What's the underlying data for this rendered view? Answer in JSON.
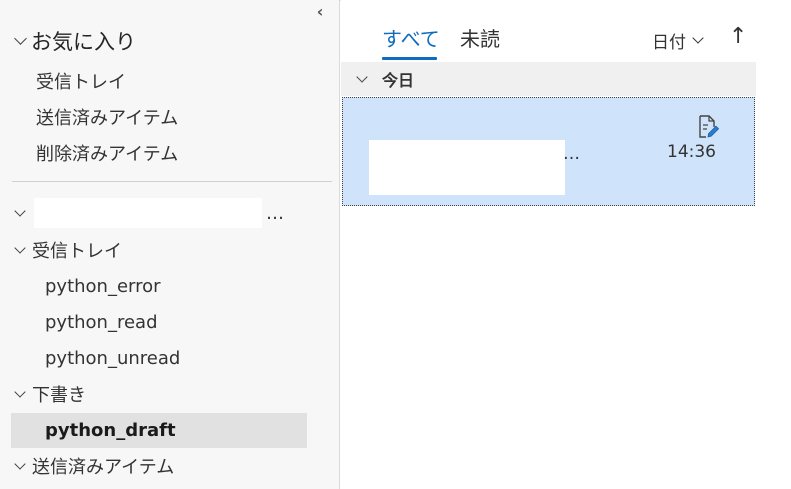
{
  "sidebar": {
    "collapse_glyph": "‹",
    "favorites": {
      "title": "お気に入り",
      "items": [
        "受信トレイ",
        "送信済みアイテム",
        "削除済みアイテム"
      ]
    },
    "account": {
      "more": "…"
    },
    "folders": {
      "inbox": "受信トレイ",
      "inbox_children": [
        "python_error",
        "python_read",
        "python_unread"
      ],
      "drafts": "下書き",
      "drafts_children": [
        "python_draft"
      ],
      "sent": "送信済みアイテム"
    }
  },
  "main": {
    "tabs": {
      "all": "すべて",
      "unread": "未読"
    },
    "sort": {
      "label": "日付",
      "direction_glyph": "↑"
    },
    "group": {
      "title": "今日"
    },
    "message": {
      "ellipsis": "…",
      "time": "14:36",
      "icon": "draft-edit-icon"
    }
  },
  "colors": {
    "accent": "#0f6cbd",
    "selected_message": "#cfe4fa",
    "selected_folder": "#e1e1e1",
    "sidebar_bg": "#f7f7f7"
  }
}
